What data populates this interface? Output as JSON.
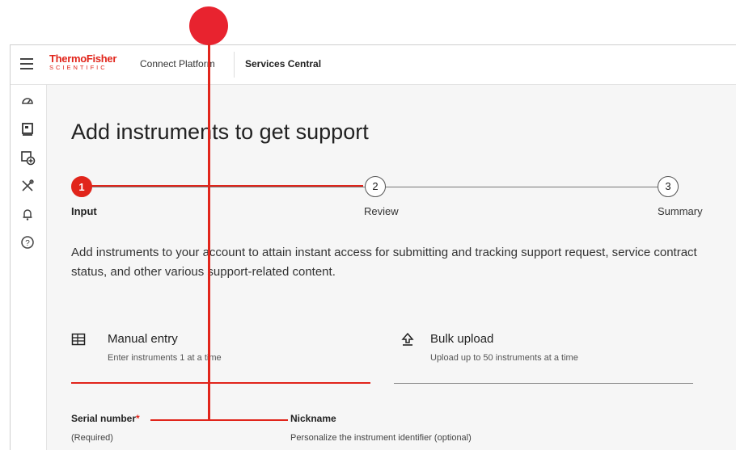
{
  "header": {
    "logo_main": "ThermoFisher",
    "logo_sub": "SCIENTIFIC",
    "platform": "Connect Platform",
    "services": "Services Central"
  },
  "sidebar": {
    "icons": [
      "dashboard-icon",
      "instrument-icon",
      "add-instrument-icon",
      "tools-icon",
      "bell-icon",
      "help-icon"
    ]
  },
  "main": {
    "title": "Add instruments to get support",
    "steps": [
      {
        "number": "1",
        "label": "Input",
        "active": true
      },
      {
        "number": "2",
        "label": "Review",
        "active": false
      },
      {
        "number": "3",
        "label": "Summary",
        "active": false
      }
    ],
    "description": "Add instruments to your account to attain instant access for submitting and tracking support request, service contract status, and other various support-related content.",
    "tabs": [
      {
        "title": "Manual entry",
        "subtitle": "Enter instruments 1 at a time",
        "icon": "grid-table-icon",
        "selected": true
      },
      {
        "title": "Bulk upload",
        "subtitle": "Upload up to 50 instruments at a time",
        "icon": "upload-icon",
        "selected": false
      }
    ],
    "fields": {
      "serial_label": "Serial number",
      "serial_required_mark": "*",
      "serial_help": "(Required)",
      "nickname_label": "Nickname",
      "nickname_help": "Personalize the instrument identifier (optional)"
    }
  },
  "colors": {
    "brand": "#e1251b",
    "background": "#f6f6f6",
    "annotation": "#e1251b"
  }
}
